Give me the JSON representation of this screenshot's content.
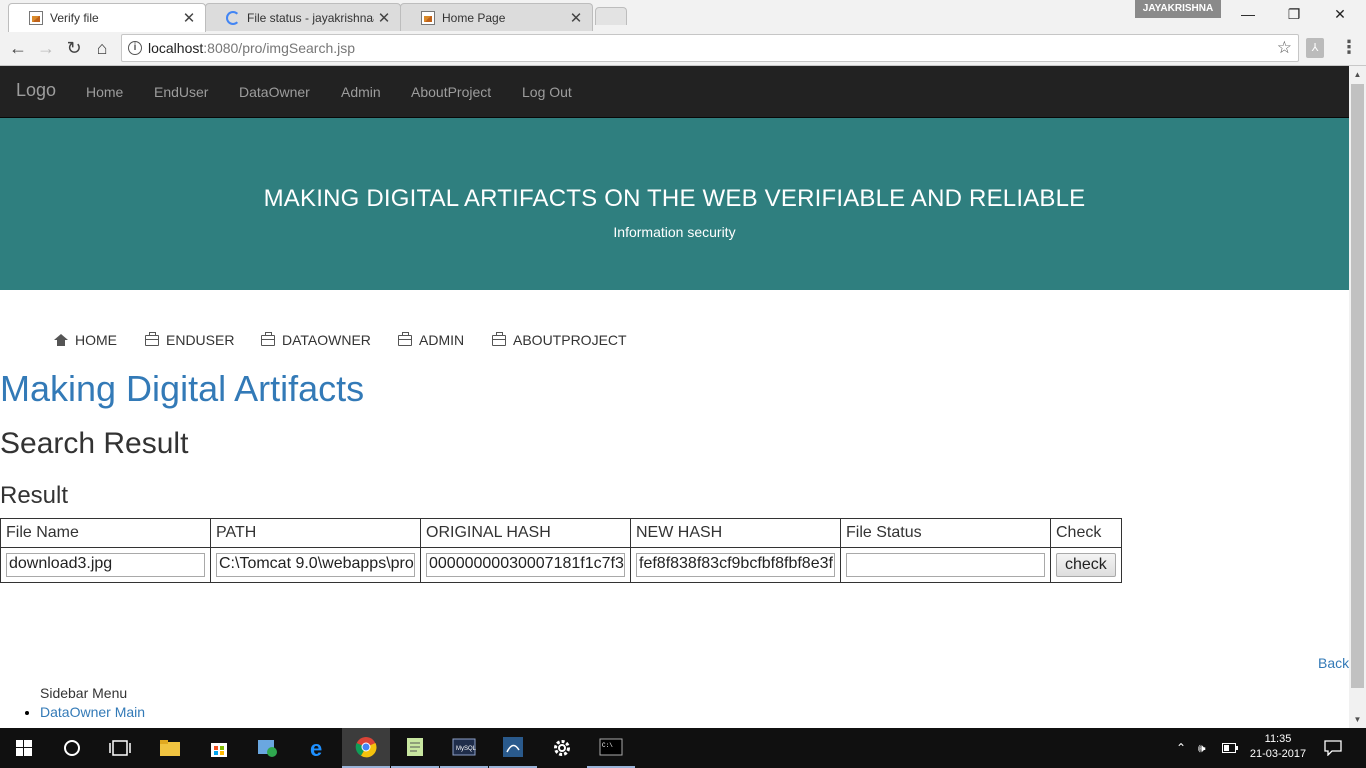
{
  "browser": {
    "tabs": [
      {
        "title": "Verify file",
        "active": true,
        "icon": "image-file-icon"
      },
      {
        "title": "File status - jayakrishnaa",
        "active": false,
        "icon": "loading-spinner-icon"
      },
      {
        "title": "Home Page",
        "active": false,
        "icon": "image-file-icon"
      }
    ],
    "profile_name": "JAYAKRISHNA",
    "url_host": "localhost",
    "url_path": ":8080/pro/imgSearch.jsp"
  },
  "topnav": {
    "brand": "Logo",
    "links": [
      "Home",
      "EndUser",
      "DataOwner",
      "Admin",
      "AboutProject",
      "Log Out"
    ]
  },
  "hero": {
    "title": "MAKING DIGITAL ARTIFACTS ON THE WEB VERIFIABLE AND RELIABLE",
    "subtitle": "Information security"
  },
  "subnav": {
    "items": [
      {
        "label": "HOME",
        "icon": "home-icon"
      },
      {
        "label": "ENDUSER",
        "icon": "briefcase-icon"
      },
      {
        "label": "DATAOWNER",
        "icon": "briefcase-icon"
      },
      {
        "label": "ADMIN",
        "icon": "briefcase-icon"
      },
      {
        "label": "ABOUTPROJECT",
        "icon": "briefcase-icon"
      }
    ]
  },
  "main": {
    "heading": "Making Digital Artifacts",
    "subheading": "Search Result",
    "section": "Result",
    "table": {
      "headers": [
        "File Name",
        "PATH",
        "ORIGINAL HASH",
        "NEW HASH",
        "File Status",
        "Check"
      ],
      "row": {
        "file_name": "download3.jpg",
        "path": "C:\\Tomcat 9.0\\webapps\\pro",
        "original_hash": "00000000030007181f1c7f3",
        "new_hash": "fef8f838f83cf9bcfbf8fbf8e3f",
        "file_status": "",
        "check_label": "check"
      }
    },
    "back_label": "Back"
  },
  "sidebar": {
    "title": "Sidebar Menu",
    "items": [
      "DataOwner Main"
    ]
  },
  "taskbar": {
    "time": "11:35",
    "date": "21-03-2017"
  }
}
